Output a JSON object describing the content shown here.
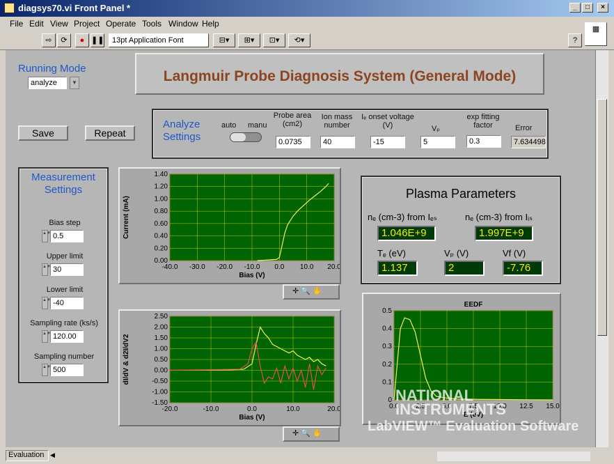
{
  "window": {
    "title": "diagsys70.vi Front Panel *"
  },
  "menus": [
    "File",
    "Edit",
    "View",
    "Project",
    "Operate",
    "Tools",
    "Window",
    "Help"
  ],
  "toolbar": {
    "font": "13pt Application Font"
  },
  "running_mode": {
    "label": "Running Mode",
    "value": "analyze"
  },
  "main_title": "Langmuir Probe Diagnosis System (General Mode)",
  "buttons": {
    "save": "Save",
    "repeat": "Repeat"
  },
  "analyze": {
    "title": "Analyze Settings",
    "auto": "auto",
    "manu": "manu",
    "probe_area_label": "Probe area (cm2)",
    "probe_area": "0.0735",
    "ion_mass_label": "Ion mass number",
    "ion_mass": "40",
    "onset_label": "Iₑ onset voltage (V)",
    "onset": "-15",
    "vp_label": "Vₚ",
    "vp": "5",
    "exp_label": "exp fitting factor",
    "exp": "0.3",
    "error_label": "Error",
    "error": "7.634498"
  },
  "measurement": {
    "title": "Measurement Settings",
    "fields": [
      {
        "label": "Bias step",
        "value": "0.5"
      },
      {
        "label": "Upper limit",
        "value": "30"
      },
      {
        "label": "Lower limit",
        "value": "-40"
      },
      {
        "label": "Sampling rate (ks/s)",
        "value": "120.00"
      },
      {
        "label": "Sampling number",
        "value": "500"
      }
    ]
  },
  "plasma": {
    "title": "Plasma Parameters",
    "ne_es_label": "nₑ (cm-3) from Iₑₛ",
    "ne_es": "1.046E+9",
    "ne_is_label": "nₑ (cm-3) from Iᵢₛ",
    "ne_is": "1.997E+9",
    "te_label": "Tₑ (eV)",
    "te": "1.137",
    "vp_label": "Vₚ (V)",
    "vp": "2",
    "vf_label": "Vf (V)",
    "vf": "-7.76"
  },
  "footer": {
    "status": "Evaluation",
    "watermark1": "NATIONAL",
    "watermark2": "INSTRUMENTS",
    "watermark3": "LabVIEW™ Evaluation Software"
  },
  "chart_data": [
    {
      "type": "line",
      "ylabel": "Current (mA)",
      "xlabel": "Bias (V)",
      "xlim": [
        -40,
        20
      ],
      "ylim": [
        0,
        1.4
      ],
      "xticks": [
        "-40.0",
        "-30.0",
        "-20.0",
        "-10.0",
        "0.0",
        "10.0",
        "20.0"
      ],
      "yticks": [
        "0.00",
        "0.20",
        "0.40",
        "0.60",
        "0.80",
        "1.00",
        "1.20",
        "1.40"
      ],
      "series": [
        {
          "color": "#f0f060",
          "x": [
            -8,
            -4,
            -1,
            0,
            1,
            2,
            3,
            5,
            7,
            9,
            11,
            13,
            15,
            17,
            18
          ],
          "y": [
            0,
            0.01,
            0.02,
            0.05,
            0.25,
            0.45,
            0.58,
            0.72,
            0.82,
            0.9,
            0.98,
            1.05,
            1.12,
            1.2,
            1.25
          ]
        }
      ]
    },
    {
      "type": "line",
      "ylabel": "dI/dV & d2I/dV2",
      "xlabel": "Bias (V)",
      "xlim": [
        -20,
        20
      ],
      "ylim": [
        -1.5,
        2.5
      ],
      "xticks": [
        "-20.0",
        "-10.0",
        "0.0",
        "10.0",
        "20.0"
      ],
      "yticks": [
        "-1.50",
        "-1.00",
        "-0.50",
        "0.00",
        "0.50",
        "1.00",
        "1.50",
        "2.00",
        "2.50"
      ],
      "series": [
        {
          "color": "#f0f060",
          "x": [
            -20,
            -5,
            -2,
            0,
            1,
            2,
            3,
            4,
            5,
            6,
            7,
            8,
            9,
            10,
            11,
            12,
            13,
            14,
            15,
            16,
            17,
            18
          ],
          "y": [
            0,
            0.02,
            0.05,
            0.3,
            1.2,
            2.0,
            1.7,
            1.5,
            1.2,
            1.1,
            1.0,
            0.9,
            0.8,
            0.9,
            0.7,
            0.6,
            0.5,
            0.6,
            0.4,
            0.5,
            0.3,
            0.2
          ]
        },
        {
          "color": "#e05050",
          "x": [
            -20,
            -3,
            -1,
            0,
            1,
            2,
            3,
            4,
            5,
            6,
            7,
            8,
            9,
            10,
            11,
            12,
            13,
            14,
            15,
            16,
            17,
            18
          ],
          "y": [
            0,
            0.05,
            0.3,
            1.0,
            1.3,
            0.2,
            -0.6,
            -0.3,
            -0.4,
            0.1,
            -0.6,
            0.2,
            -0.4,
            0.1,
            -0.5,
            0.0,
            -0.8,
            0.3,
            -0.9,
            0.2,
            -0.2,
            0.1
          ]
        }
      ]
    },
    {
      "type": "line",
      "title": "EEDF",
      "xlim": [
        0,
        15
      ],
      "ylim": [
        0,
        0.5
      ],
      "xticks": [
        "0.0",
        "2.5",
        "5.0",
        "7.5",
        "10.0",
        "12.5",
        "15.0"
      ],
      "yticks": [
        "0",
        "0.1",
        "0.2",
        "0.3",
        "0.4",
        "0.5"
      ],
      "xlabel": "E (eV)",
      "series": [
        {
          "color": "#f0f060",
          "x": [
            0,
            0.3,
            0.6,
            1,
            1.5,
            2,
            2.5,
            3,
            3.5,
            4,
            5,
            6,
            8,
            10,
            12,
            15
          ],
          "y": [
            0,
            0.2,
            0.4,
            0.46,
            0.45,
            0.38,
            0.25,
            0.12,
            0.05,
            0.02,
            0.01,
            0.005,
            0.003,
            0.002,
            0.001,
            0
          ]
        }
      ]
    }
  ]
}
